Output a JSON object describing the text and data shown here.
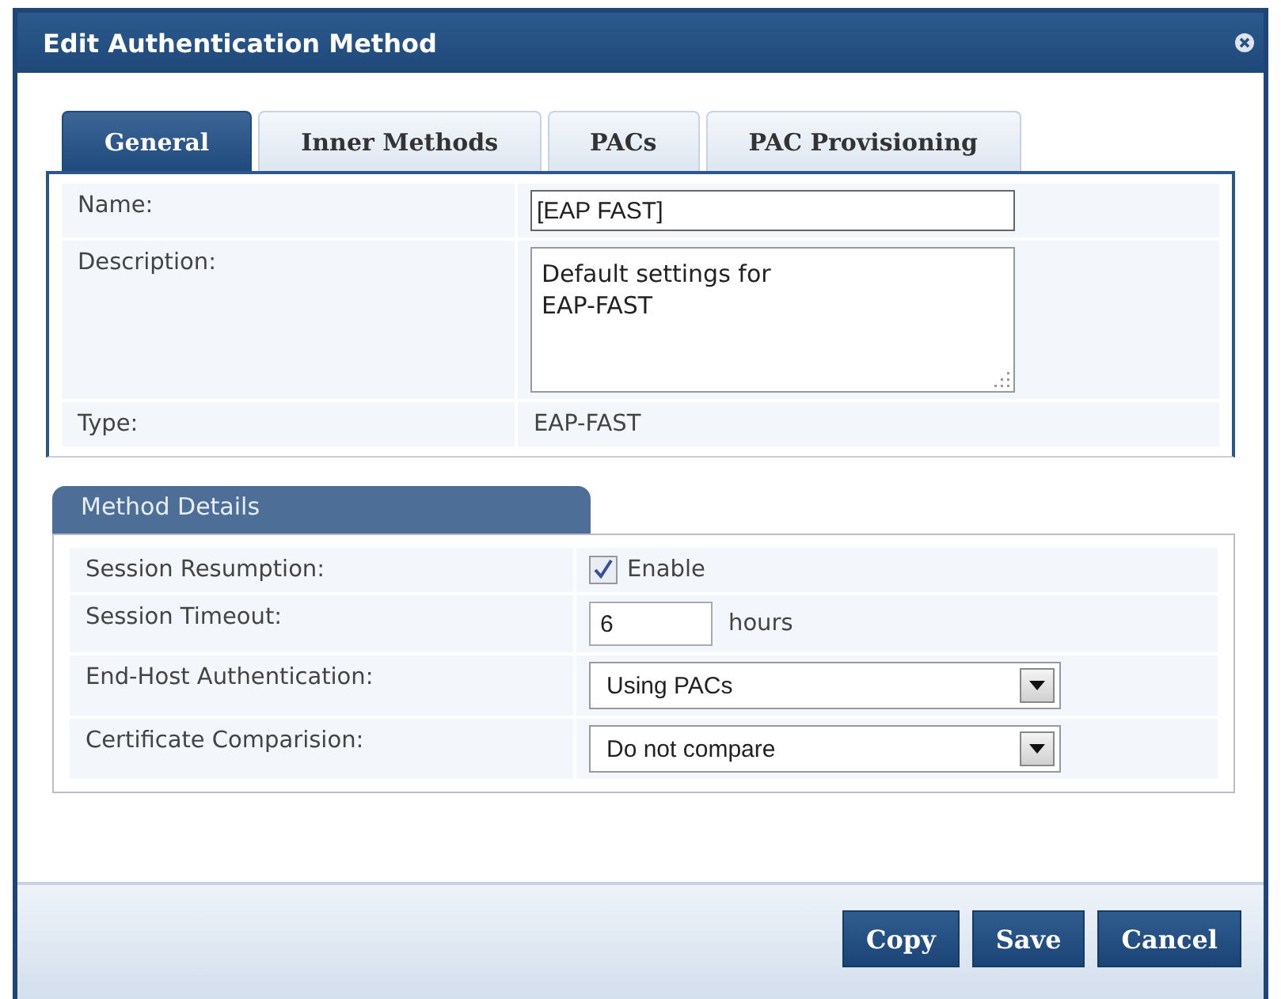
{
  "window": {
    "title": "Edit Authentication Method"
  },
  "tabs": [
    {
      "label": "General",
      "selected": true
    },
    {
      "label": "Inner Methods",
      "selected": false
    },
    {
      "label": "PACs",
      "selected": false
    },
    {
      "label": "PAC Provisioning",
      "selected": false
    }
  ],
  "general": {
    "rows": [
      {
        "kind": "text-field",
        "label": "Name:",
        "value": "[EAP FAST]"
      },
      {
        "kind": "textarea",
        "label": "Description:",
        "value": "Default settings for\nEAP-FAST"
      },
      {
        "kind": "static",
        "label": "Type:",
        "value": "EAP-FAST"
      }
    ]
  },
  "method_details": {
    "title": "Method Details",
    "rows": [
      {
        "kind": "checkbox",
        "label": "Session Resumption:",
        "checked": true,
        "option": "Enable"
      },
      {
        "kind": "number-field",
        "label": "Session Timeout:",
        "value": "6",
        "unit": "hours"
      },
      {
        "kind": "dropdown",
        "label": "End-Host Authentication:",
        "value": "Using PACs"
      },
      {
        "kind": "dropdown",
        "label": "Certificate Comparision:",
        "value": "Do not compare"
      }
    ]
  },
  "buttons": [
    "Copy",
    "Save",
    "Cancel"
  ]
}
